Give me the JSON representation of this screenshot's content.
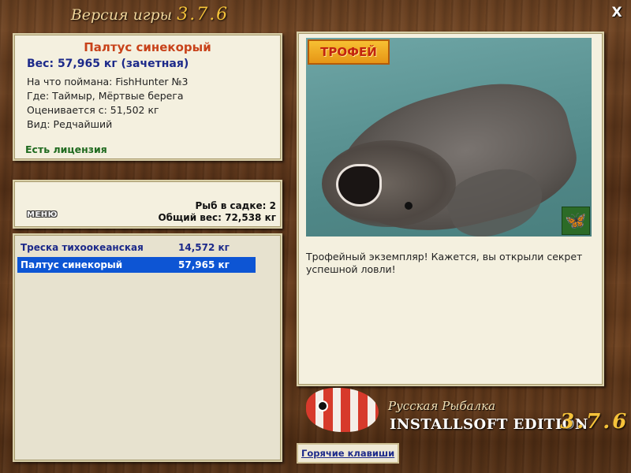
{
  "window": {
    "title": "Версия игры",
    "version": "3.7.6",
    "close_label": "X"
  },
  "fish": {
    "name": "Палтус синекорый",
    "weight": "Вес: 57,965 кг (зачетная)",
    "caught_with": "На что поймана: FishHunter №3",
    "location": "Где: Таймыр, Мёртвые берега",
    "valued_from": "Оценивается с: 51,502 кг",
    "rarity": "Вид: Редчайший",
    "license": "Есть лицензия"
  },
  "cage": {
    "menu_label": "МЕНЮ",
    "count": "Рыб в садке: 2",
    "total_weight": "Общий вес: 72,538 кг"
  },
  "catch_list": [
    {
      "name": "Треска тихоокеанская",
      "weight": "14,572 кг",
      "selected": false
    },
    {
      "name": "Палтус синекорый",
      "weight": "57,965 кг",
      "selected": true
    }
  ],
  "photo": {
    "trophy_badge": "ТРОФЕЙ",
    "badge_icon": "butterfly-icon"
  },
  "description": "Трофейный экземпляр! Кажется, вы открыли секрет успешной ловли!",
  "branding": {
    "subtitle": "Русская Рыбалка",
    "edition": "INSTALLSOFT EDITION",
    "version": "3.7.6"
  },
  "hotkeys_label": "Горячие клавиши",
  "colors": {
    "accent_selected": "#0d55d4",
    "fish_name": "#c8421a",
    "text_blue": "#1d2a8a",
    "license_green": "#1f6a1f"
  }
}
